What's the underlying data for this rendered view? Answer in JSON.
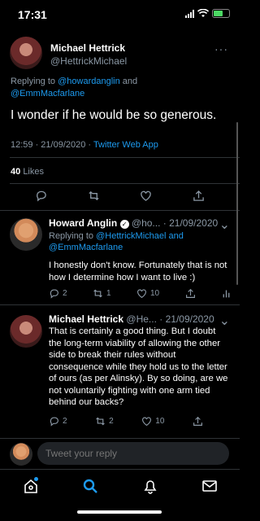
{
  "status_bar": {
    "time": "17:31"
  },
  "main_tweet": {
    "name": "Michael Hettrick",
    "handle": "@HettrickMichael",
    "replying_prefix": "Replying to",
    "replying_to_1": "@howardanglin",
    "replying_joiner": "and",
    "replying_to_2": "@EmmMacfarlane",
    "text": "I wonder if he would be so generous.",
    "time": "12:59 · 21/09/2020 ·",
    "source": "Twitter Web App",
    "like_count": "40",
    "likes_label": "Likes"
  },
  "replies": [
    {
      "name": "Howard Anglin",
      "handle": "@ho...",
      "date": "· 21/09/2020",
      "replying_prefix": "Replying to",
      "replying_to_1": "@HettrickMichael",
      "replying_joiner": "and",
      "replying_to_2": "@EmmMacfarlane",
      "text": "I honestly don't know. Fortunately that is not how I determine how I want to live :)",
      "reply_count": "2",
      "retweet_count": "1",
      "like_count": "10"
    },
    {
      "name": "Michael Hettrick",
      "handle": "@He...",
      "date": "· 21/09/2020",
      "text": "That is certainly a good thing. But I doubt the long-term viability of allowing the other side to break their rules without consequence while they hold us to the letter of ours (as per Alinsky). By so doing, are we not voluntarily fighting with one arm tied behind our backs?",
      "reply_count": "2",
      "retweet_count": "2",
      "like_count": "10"
    }
  ],
  "reply_bar": {
    "placeholder": "Tweet your reply"
  },
  "colors": {
    "accent": "#1d9bf0",
    "muted": "#8b98a5",
    "background": "#000000"
  },
  "icons": [
    "reply-icon",
    "retweet-icon",
    "like-icon",
    "share-icon",
    "analytics-icon",
    "home-icon",
    "search-icon",
    "notifications-icon",
    "messages-icon"
  ]
}
